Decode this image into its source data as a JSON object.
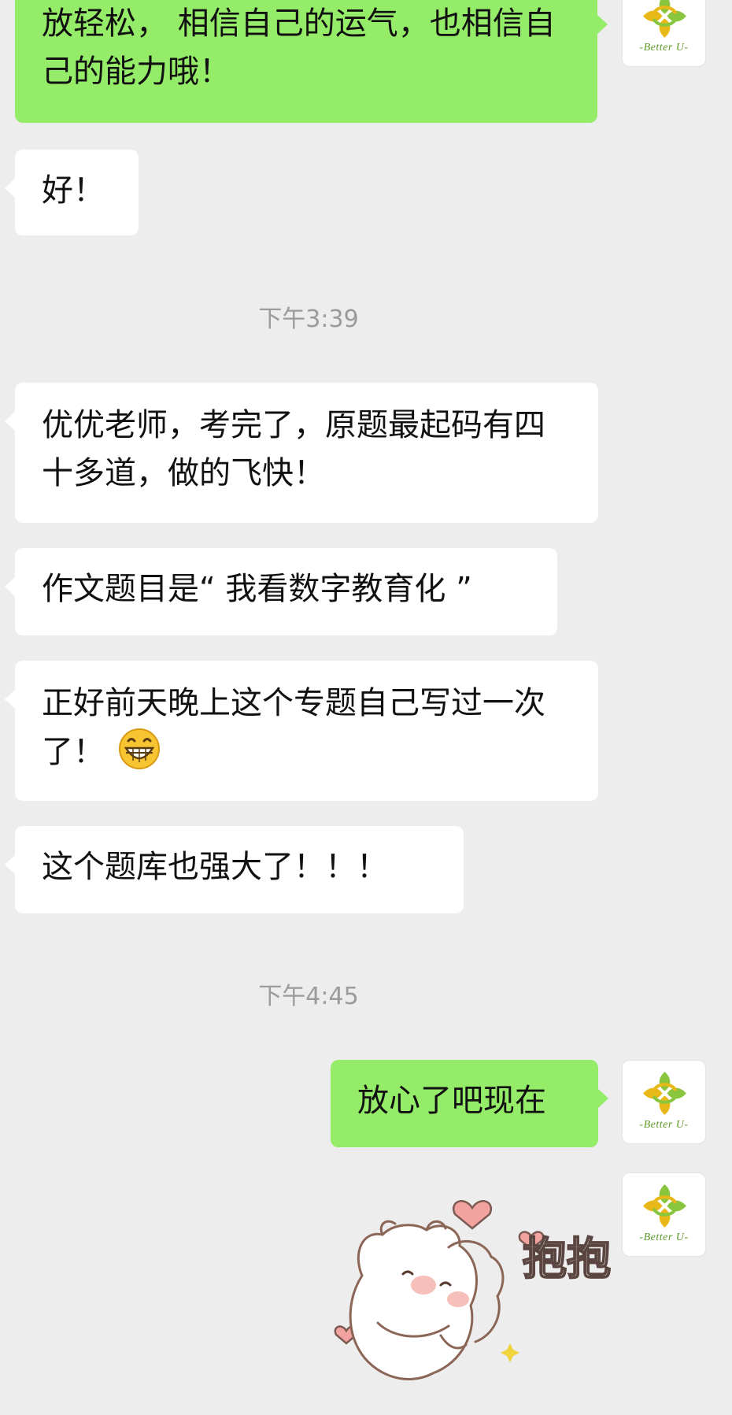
{
  "avatar": {
    "brand_text": "-Better U-",
    "accent_green": "#8ac53e",
    "accent_gold": "#e8b818"
  },
  "messages": [
    {
      "side": "out",
      "text": "放轻松， 相信自己的运气，也相信自己的能力哦！"
    },
    {
      "side": "in",
      "text": "好！"
    },
    {
      "type": "time",
      "text": "下午3:39"
    },
    {
      "side": "in",
      "text": "优优老师，考完了，原题最起码有四十多道，做的飞快！"
    },
    {
      "side": "in",
      "text": "作文题目是“ 我看数字教育化 ”"
    },
    {
      "side": "in",
      "text": "正好前天晚上这个专题自己写过一次了！",
      "emoji": "grinning-face-icon"
    },
    {
      "side": "in",
      "text": "这个题库也强大了！！！"
    },
    {
      "type": "time",
      "text": "下午4:45"
    },
    {
      "side": "out",
      "text": "放心了吧现在"
    },
    {
      "side": "out",
      "type": "sticker",
      "sticker_text": "抱抱",
      "sticker_icon": "hug-bear-sticker"
    }
  ],
  "colors": {
    "background": "#ededed",
    "incoming_bubble": "#ffffff",
    "outgoing_bubble": "#95ec69",
    "timestamp": "#9b9b9b"
  }
}
